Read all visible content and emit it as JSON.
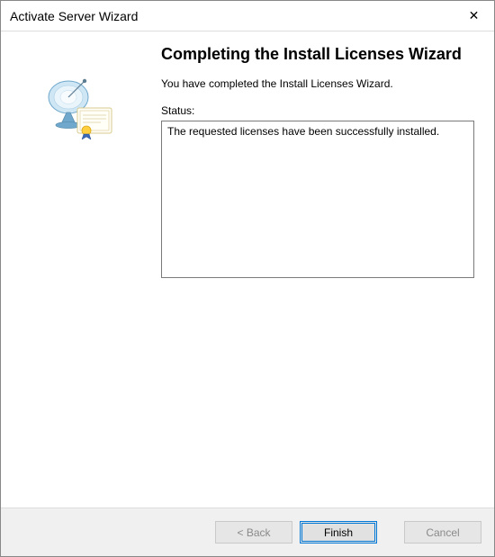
{
  "window": {
    "title": "Activate Server Wizard",
    "close_glyph": "✕"
  },
  "main": {
    "heading": "Completing the Install Licenses Wizard",
    "intro": "You have completed the Install Licenses Wizard.",
    "status_label": "Status:",
    "status_text": "The requested licenses have been successfully installed."
  },
  "footer": {
    "back": "< Back",
    "finish": "Finish",
    "cancel": "Cancel"
  },
  "icons": {
    "wizard_icon": "satellite-license-icon"
  }
}
